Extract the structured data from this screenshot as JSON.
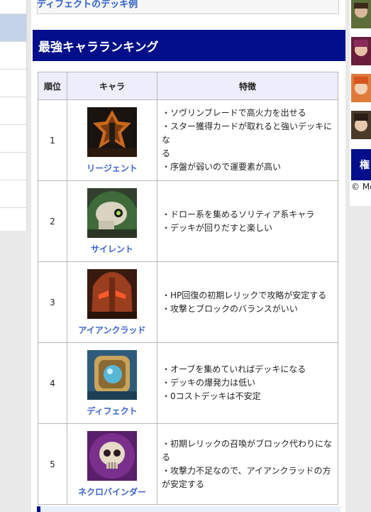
{
  "prev_link": "ディフェクトのデッキ例",
  "section_title": "最強キャラランキング",
  "table": {
    "headers": [
      "順位",
      "キャラ",
      "特徴"
    ],
    "rows": [
      {
        "rank": "1",
        "name": "リージェント",
        "features": [
          "・ソヴリンブレードで高火力を出せる",
          "・スター獲得カードが取れると強いデッキにな",
          "る",
          "・序盤が弱いので運要素が高い"
        ]
      },
      {
        "rank": "2",
        "name": "サイレント",
        "features": [
          "・ドロー系を集めるソリティア系キャラ",
          "・デッキが回りだすと楽しい"
        ]
      },
      {
        "rank": "3",
        "name": "アイアンクラッド",
        "features": [
          "・HP回復の初期レリックで攻略が安定する",
          "・攻撃とブロックのバランスがいい"
        ]
      },
      {
        "rank": "4",
        "name": "ディフェクト",
        "features": [
          "・オーブを集めていればデッキになる",
          "・デッキの爆発力は低い",
          "・0コストデッキは不安定"
        ]
      },
      {
        "rank": "5",
        "name": "ネクロバインダー",
        "features": [
          "・初期レリックの召喚がブロック代わりにな",
          "る",
          "・攻撃力不足なので、アイアンクラッドの方",
          "が安定する"
        ]
      }
    ]
  },
  "right": {
    "heading": "権",
    "copyright": "© Me"
  },
  "colors": {
    "header_bg": "#030f8a",
    "link": "#3b63c9",
    "table_head_bg": "#ededfb"
  }
}
